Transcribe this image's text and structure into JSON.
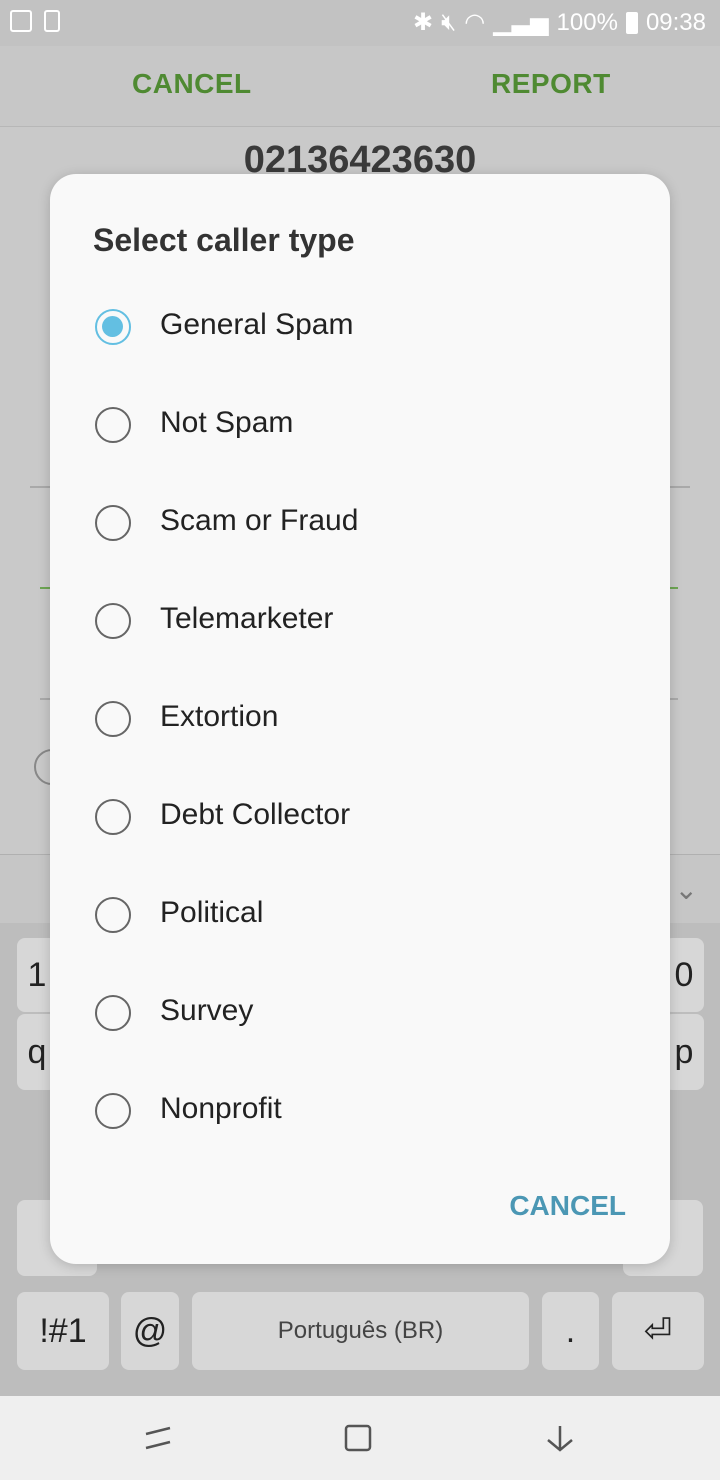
{
  "status_bar": {
    "battery": "100%",
    "time": "09:38",
    "icons": [
      "image-icon",
      "battery-saver-icon",
      "bluetooth-icon",
      "mute-icon",
      "wifi-icon",
      "signal-icon",
      "battery-icon"
    ]
  },
  "app_bar": {
    "cancel_label": "CANCEL",
    "report_label": "REPORT"
  },
  "page": {
    "phone_number": "02136423630"
  },
  "dialog": {
    "title": "Select caller type",
    "options": [
      {
        "label": "General Spam",
        "selected": true
      },
      {
        "label": "Not Spam",
        "selected": false
      },
      {
        "label": "Scam or Fraud",
        "selected": false
      },
      {
        "label": "Telemarketer",
        "selected": false
      },
      {
        "label": "Extortion",
        "selected": false
      },
      {
        "label": "Debt Collector",
        "selected": false
      },
      {
        "label": "Political",
        "selected": false
      },
      {
        "label": "Survey",
        "selected": false
      },
      {
        "label": "Nonprofit",
        "selected": false
      }
    ],
    "cancel_label": "CANCEL",
    "accent_color": "#63bfe2"
  },
  "keyboard": {
    "symbols_key": "!#1",
    "at_key": "@",
    "space_label": "Português (BR)",
    "period_key": ".",
    "row1_left": "1",
    "row1_right": "0",
    "row2_left": "q",
    "row2_right": "p"
  },
  "colors": {
    "app_action": "#4f8a32",
    "dialog_action": "#4b97b4"
  }
}
